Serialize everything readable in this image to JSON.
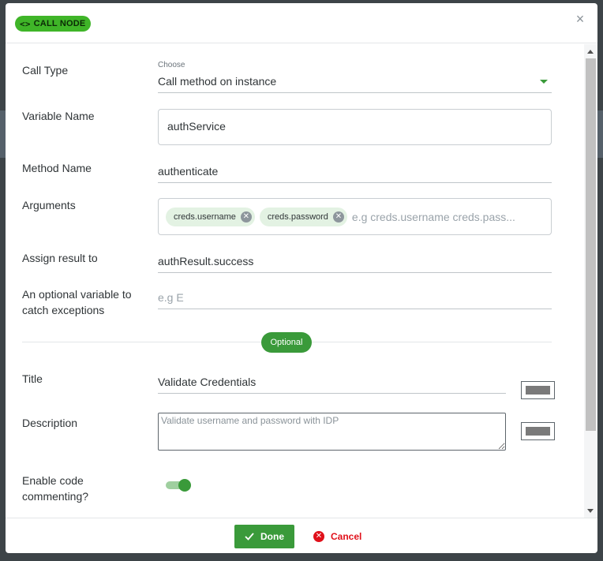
{
  "header": {
    "badge_icon": "<>",
    "badge_label": "CALL NODE",
    "close_icon": "×"
  },
  "form": {
    "call_type": {
      "label": "Call Type",
      "caption": "Choose",
      "value": "Call method on instance"
    },
    "variable_name": {
      "label": "Variable Name",
      "value": "authService"
    },
    "method_name": {
      "label": "Method Name",
      "value": "authenticate"
    },
    "arguments": {
      "label": "Arguments",
      "chips": [
        "creds.username",
        "creds.password"
      ],
      "placeholder": "e.g creds.username creds.pass..."
    },
    "assign_result": {
      "label": "Assign result to",
      "value": "authResult.success"
    },
    "catch_variable": {
      "label_line1": "An optional variable to",
      "label_line2": "catch exceptions",
      "placeholder": "e.g E"
    },
    "optional_label": "Optional",
    "title": {
      "label": "Title",
      "value": "Validate Credentials"
    },
    "description": {
      "label": "Description",
      "placeholder": "Validate username and password with IDP"
    },
    "code_commenting": {
      "label_line1": "Enable code",
      "label_line2": "commenting?",
      "enabled": true
    }
  },
  "footer": {
    "done_label": "Done",
    "cancel_label": "Cancel"
  },
  "colors": {
    "accent": "#3a9a3a",
    "badge": "#3fb528",
    "danger": "#e0101a"
  }
}
